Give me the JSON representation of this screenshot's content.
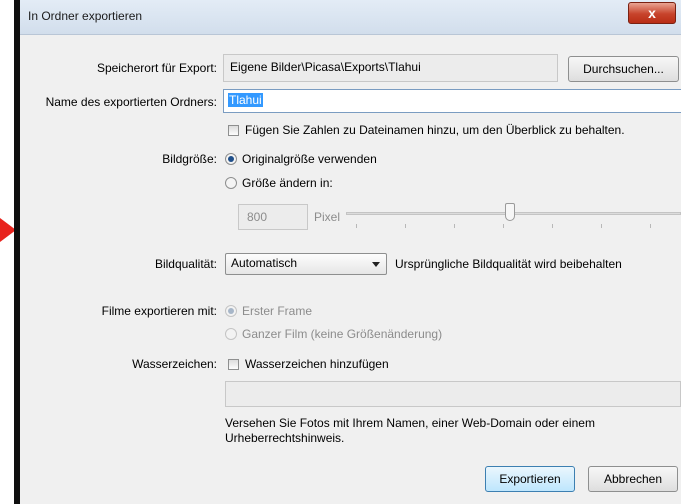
{
  "dialog": {
    "title": "In Ordner exportieren",
    "close_label": "x"
  },
  "location": {
    "label": "Speicherort für Export:",
    "path": "Eigene Bilder\\Picasa\\Exports\\Tlahui",
    "browse_button": "Durchsuchen..."
  },
  "folder_name": {
    "label": "Name des exportierten Ordners:",
    "value": "Tlahui"
  },
  "add_numbers": {
    "label": "Fügen Sie Zahlen zu Dateinamen hinzu, um den Überblick zu behalten.",
    "checked": false
  },
  "image_size": {
    "label": "Bildgröße:",
    "option_original": "Originalgröße verwenden",
    "option_resize": "Größe ändern in:",
    "pixel_value": "800",
    "pixel_unit": "Pixel",
    "slider_level": 0.49
  },
  "quality": {
    "label": "Bildqualität:",
    "selected": "Automatisch",
    "description": "Ursprüngliche Bildqualität wird beibehalten"
  },
  "movies": {
    "label": "Filme exportieren mit:",
    "option_first_frame": "Erster Frame",
    "option_full_movie": "Ganzer Film (keine Größenänderung)"
  },
  "watermark": {
    "label": "Wasserzeichen:",
    "checkbox_label": "Wasserzeichen hinzufügen",
    "help_line1": "Versehen Sie Fotos mit Ihrem Namen, einer Web-Domain oder einem",
    "help_line2": "Urheberrechtshinweis."
  },
  "buttons": {
    "export": "Exportieren",
    "cancel": "Abbrechen"
  },
  "colors": {
    "selection": "#3399ff",
    "close_button": "#c7432b",
    "pointer_arrow": "#e8231d"
  }
}
